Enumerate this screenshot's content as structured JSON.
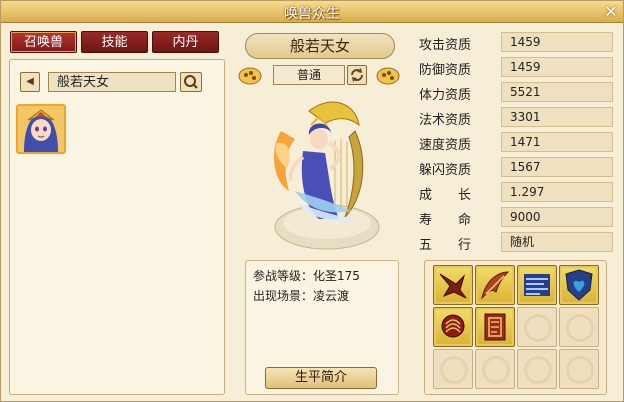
{
  "window": {
    "title": "唤兽众生",
    "close_glyph": "✕"
  },
  "tabs": [
    {
      "label": "召唤兽",
      "active": true
    },
    {
      "label": "技能",
      "active": false
    },
    {
      "label": "内丹",
      "active": false
    }
  ],
  "pet_list": {
    "selected_name": "般若天女"
  },
  "pet": {
    "name": "般若天女",
    "type": "普通"
  },
  "stats": [
    {
      "label": "攻击资质",
      "value": "1459"
    },
    {
      "label": "防御资质",
      "value": "1459"
    },
    {
      "label": "体力资质",
      "value": "5521"
    },
    {
      "label": "法术资质",
      "value": "3301"
    },
    {
      "label": "速度资质",
      "value": "1471"
    },
    {
      "label": "躲闪资质",
      "value": "1567"
    },
    {
      "label": "成　　长",
      "value": "1.297"
    },
    {
      "label": "寿　　命",
      "value": "9000"
    },
    {
      "label": "五　　行",
      "value": "随机"
    }
  ],
  "info": {
    "level_label": "参战等级：",
    "level_value": "化圣175",
    "scene_label": "出现场景：",
    "scene_value": "凌云渡",
    "bio_button": "生平简介"
  },
  "skills": {
    "filled": [
      "eagle-skill-icon",
      "feather-skill-icon",
      "speed-lines-skill-icon",
      "shield-heart-skill-icon",
      "head-rune-skill-icon",
      "scroll-rune-skill-icon"
    ],
    "total_slots": 12
  },
  "colors": {
    "tab_red": "#7e1a17",
    "panel_bg": "#f7eed8",
    "skill_gold": "#e2bc3d",
    "selected_border": "#f0a42c"
  }
}
